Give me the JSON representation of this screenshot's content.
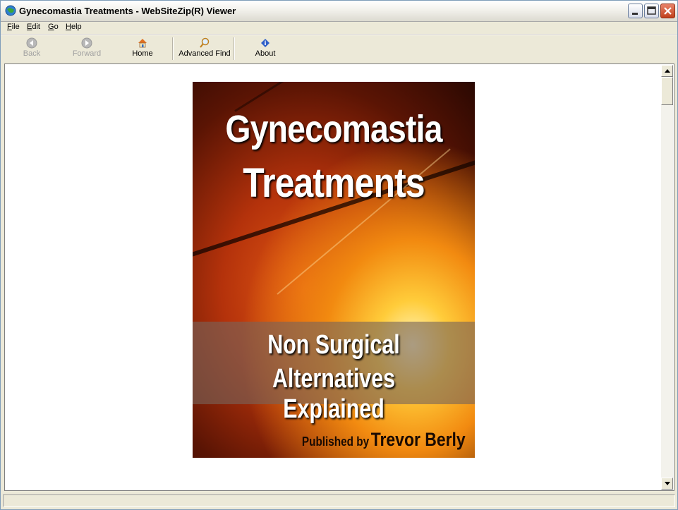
{
  "window": {
    "title": "Gynecomastia Treatments - WebSiteZip(R) Viewer"
  },
  "menu": [
    {
      "label": "File",
      "accel": "F",
      "rest": "ile"
    },
    {
      "label": "Edit",
      "accel": "E",
      "rest": "dit"
    },
    {
      "label": "Go",
      "accel": "G",
      "rest": "o"
    },
    {
      "label": "Help",
      "accel": "H",
      "rest": "elp"
    }
  ],
  "toolbar": {
    "back": "Back",
    "forward": "Forward",
    "home": "Home",
    "advanced_find": "Advanced Find",
    "about": "About"
  },
  "cover": {
    "title_line1": "Gynecomastia",
    "title_line2": "Treatments",
    "subtitle_line1": "Non Surgical",
    "subtitle_line2": "Alternatives Explained",
    "published_by": "Published by",
    "author": "Trevor Berly"
  },
  "colors": {
    "chrome": "#ece9d8",
    "close_button": "#c1411c",
    "content_bg": "#ffffff"
  }
}
